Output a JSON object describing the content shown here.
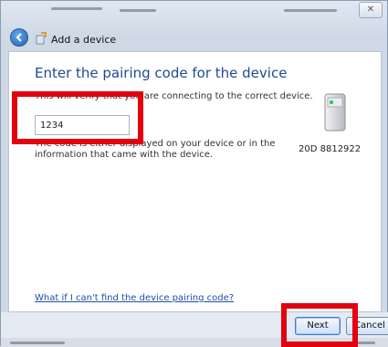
{
  "window": {
    "title": "Add a device"
  },
  "content": {
    "heading": "Enter the pairing code for the device",
    "description": "This will verify that you are connecting to the correct device.",
    "code_value": "1234",
    "info_text": "The code is either displayed on your device or in the information that came with the device.",
    "device_name": "20D 8812922",
    "help_link": "What if I can't find the device pairing code?"
  },
  "footer": {
    "next_label": "Next",
    "cancel_label": "Cancel"
  },
  "colors": {
    "highlight": "#e3000f",
    "heading": "#1e4a92",
    "link": "#1f4ea6"
  }
}
